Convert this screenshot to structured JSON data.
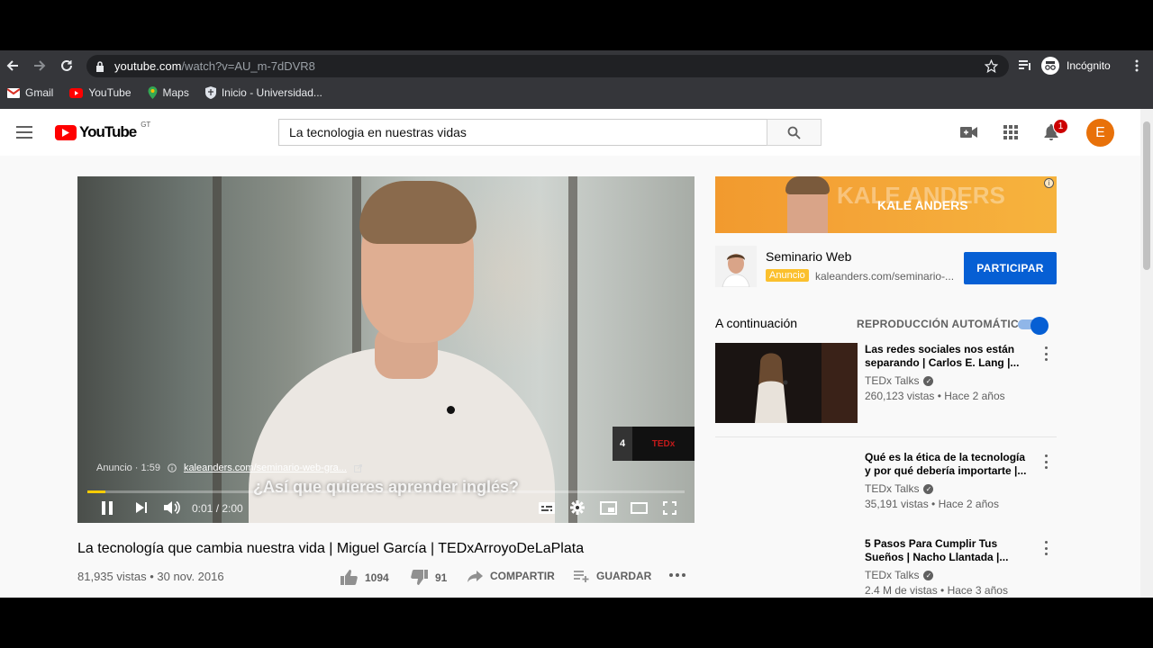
{
  "browser": {
    "url_host": "youtube.com",
    "url_path": "/watch?v=AU_m-7dDVR8",
    "profile_label": "Incógnito",
    "bookmarks": [
      {
        "label": "Gmail",
        "icon": "gmail-icon"
      },
      {
        "label": "YouTube",
        "icon": "youtube-icon"
      },
      {
        "label": "Maps",
        "icon": "maps-icon"
      },
      {
        "label": "Inicio - Universidad...",
        "icon": "shield-icon"
      }
    ]
  },
  "header": {
    "logo_text": "YouTube",
    "logo_country": "GT",
    "search_value": "La tecnologia en nuestras vidas",
    "notification_count": "1",
    "avatar_letter": "E"
  },
  "player": {
    "ad_label": "Anuncio · 1:59",
    "ad_link": "kaleanders.com/seminario-web-gra...",
    "subtitle": "¿Así que quieres aprender inglés?",
    "time": "0:01 / 2:00",
    "progress": 0.01,
    "preview_number": "4",
    "preview_logo": "TEDx",
    "accent_color": "#ffcc00"
  },
  "video": {
    "title": "La tecnología que cambia nuestra vida | Miguel García | TEDxArroyoDeLaPlata",
    "views_date": "81,935 vistas • 30 nov. 2016",
    "likes": "1094",
    "dislikes": "91",
    "share_label": "COMPARTIR",
    "save_label": "GUARDAR"
  },
  "ad": {
    "banner_bg_text": "KALE ANDERS",
    "banner_brand": "KALE ANDERS",
    "title": "Seminario Web",
    "badge": "Anuncio",
    "domain": "kaleanders.com/seminario-...",
    "cta": "PARTICIPAR",
    "cta_color": "#065fd4"
  },
  "sidebar": {
    "up_next": "A continuación",
    "autoplay": "REPRODUCCIÓN AUTOMÁTICA",
    "autoplay_on": true,
    "recommendations": [
      {
        "title": "Las redes sociales nos están separando | Carlos E. Lang |...",
        "channel": "TEDx Talks",
        "meta": "260,123 vistas • Hace 2 años"
      },
      {
        "title": "Qué es la ética de la tecnología y por qué debería importarte |...",
        "channel": "TEDx Talks",
        "meta": "35,191 vistas • Hace 2 años"
      },
      {
        "title": "5 Pasos Para Cumplir Tus Sueños | Nacho Llantada |...",
        "channel": "TEDx Talks",
        "meta": "2.4 M de vistas • Hace 3 años"
      }
    ]
  }
}
